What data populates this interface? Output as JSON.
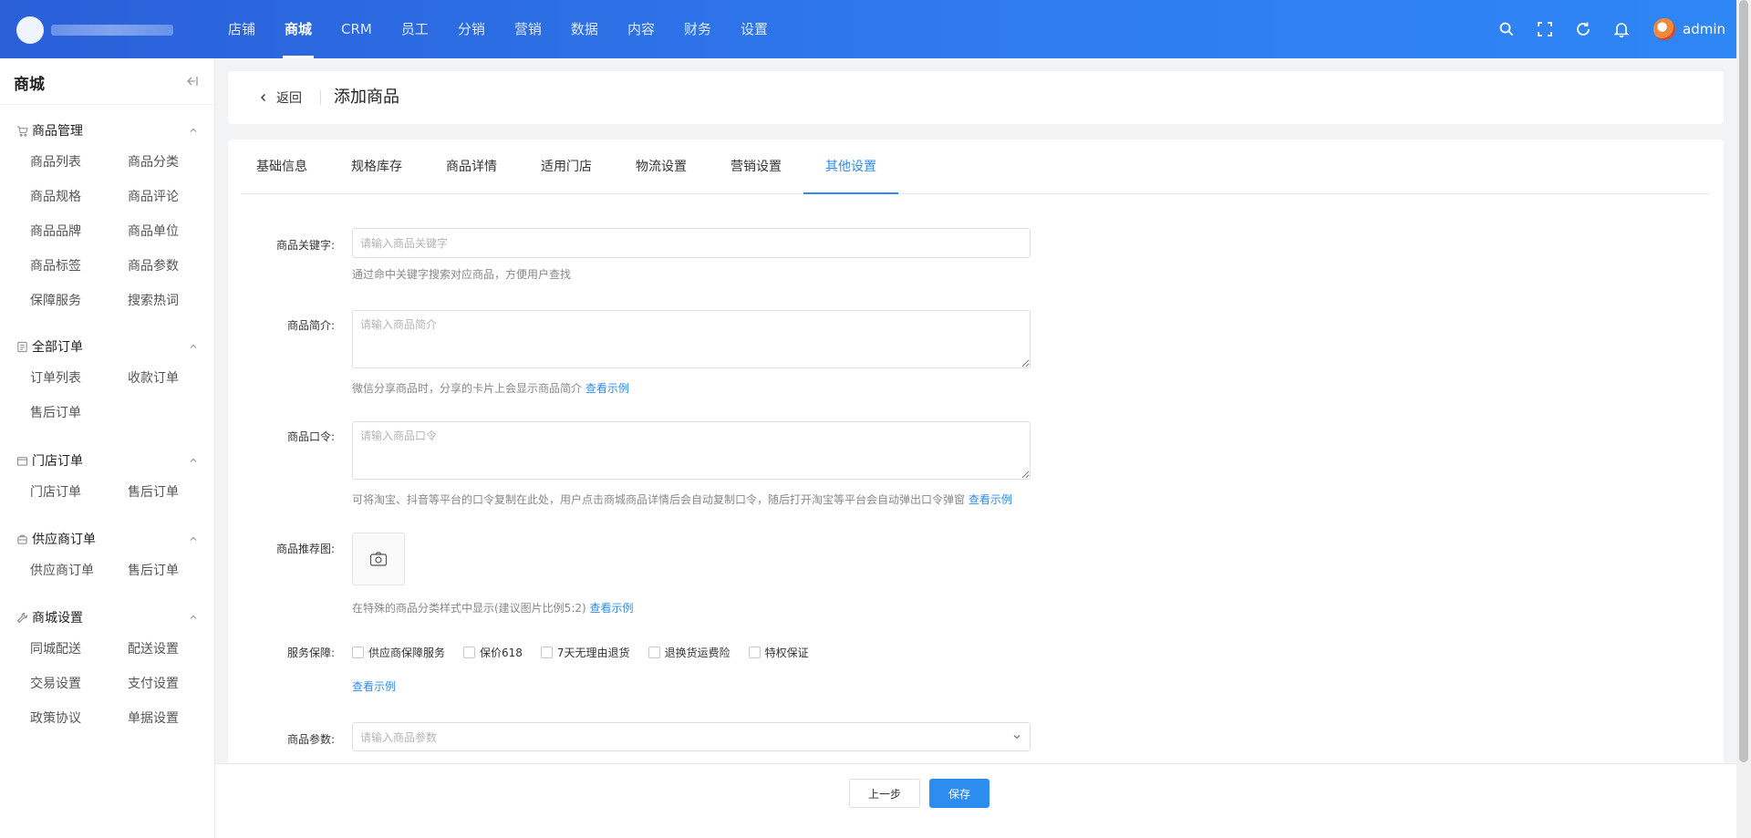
{
  "header": {
    "nav": [
      "店铺",
      "商城",
      "CRM",
      "员工",
      "分销",
      "营销",
      "数据",
      "内容",
      "财务",
      "设置"
    ],
    "active_nav": 1,
    "user": "admin"
  },
  "sidebar": {
    "title": "商城",
    "groups": [
      {
        "title": "商品管理",
        "icon": "cart-icon",
        "items": [
          "商品列表",
          "商品分类",
          "商品规格",
          "商品评论",
          "商品品牌",
          "商品单位",
          "商品标签",
          "商品参数",
          "保障服务",
          "搜索热词"
        ]
      },
      {
        "title": "全部订单",
        "icon": "order-icon",
        "items": [
          "订单列表",
          "收款订单",
          "售后订单"
        ]
      },
      {
        "title": "门店订单",
        "icon": "store-icon",
        "items": [
          "门店订单",
          "售后订单"
        ]
      },
      {
        "title": "供应商订单",
        "icon": "supplier-icon",
        "items": [
          "供应商订单",
          "售后订单"
        ]
      },
      {
        "title": "商城设置",
        "icon": "wrench-icon",
        "items": [
          "同城配送",
          "配送设置",
          "交易设置",
          "支付设置",
          "政策协议",
          "单据设置"
        ]
      }
    ]
  },
  "page": {
    "back_label": "返回",
    "title": "添加商品"
  },
  "tabs": {
    "items": [
      "基础信息",
      "规格库存",
      "商品详情",
      "适用门店",
      "物流设置",
      "营销设置",
      "其他设置"
    ],
    "active": 6
  },
  "form": {
    "keywords": {
      "label": "商品关键字:",
      "placeholder": "请输入商品关键字",
      "hint": "通过命中关键字搜索对应商品，方便用户查找"
    },
    "intro": {
      "label": "商品简介:",
      "placeholder": "请输入商品简介",
      "hint": "微信分享商品时，分享的卡片上会显示商品简介",
      "link": "查看示例"
    },
    "command": {
      "label": "商品口令:",
      "placeholder": "请输入商品口令",
      "hint": "可将淘宝、抖音等平台的口令复制在此处，用户点击商城商品详情后会自动复制口令，随后打开淘宝等平台会自动弹出口令弹窗",
      "link": "查看示例"
    },
    "recommend_image": {
      "label": "商品推荐图:",
      "hint": "在特殊的商品分类样式中显示(建议图片比例5:2)",
      "link": "查看示例"
    },
    "service": {
      "label": "服务保障:",
      "options": [
        "供应商保障服务",
        "保价618",
        "7天无理由退货",
        "退换货运费险",
        "特权保证"
      ],
      "link": "查看示例"
    },
    "params": {
      "label": "商品参数:",
      "placeholder": "请输入商品参数"
    }
  },
  "footer": {
    "prev_label": "上一步",
    "save_label": "保存"
  },
  "colors": {
    "primary": "#2d8cf0",
    "topbar": "#2f7cf0"
  }
}
